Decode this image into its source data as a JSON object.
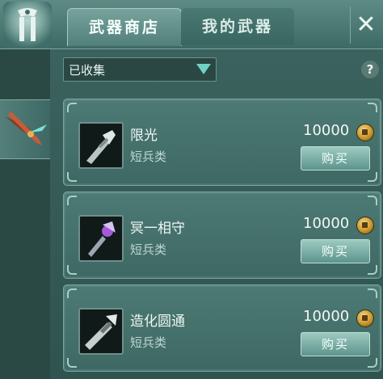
{
  "tabs": [
    {
      "label": "武器商店",
      "active": true
    },
    {
      "label": "我的武器",
      "active": false
    }
  ],
  "close_label": "✕",
  "filter": {
    "selected": "已收集"
  },
  "help_label": "?",
  "items": [
    {
      "name": "限光",
      "category": "短兵类",
      "price": "10000",
      "buy_label": "购买"
    },
    {
      "name": "冥一相守",
      "category": "短兵类",
      "price": "10000",
      "buy_label": "购买"
    },
    {
      "name": "造化圆通",
      "category": "短兵类",
      "price": "10000",
      "buy_label": "购买"
    }
  ],
  "colors": {
    "accent": "#6fd3c6",
    "panel": "#3b625e",
    "coin": "#c9972f"
  }
}
